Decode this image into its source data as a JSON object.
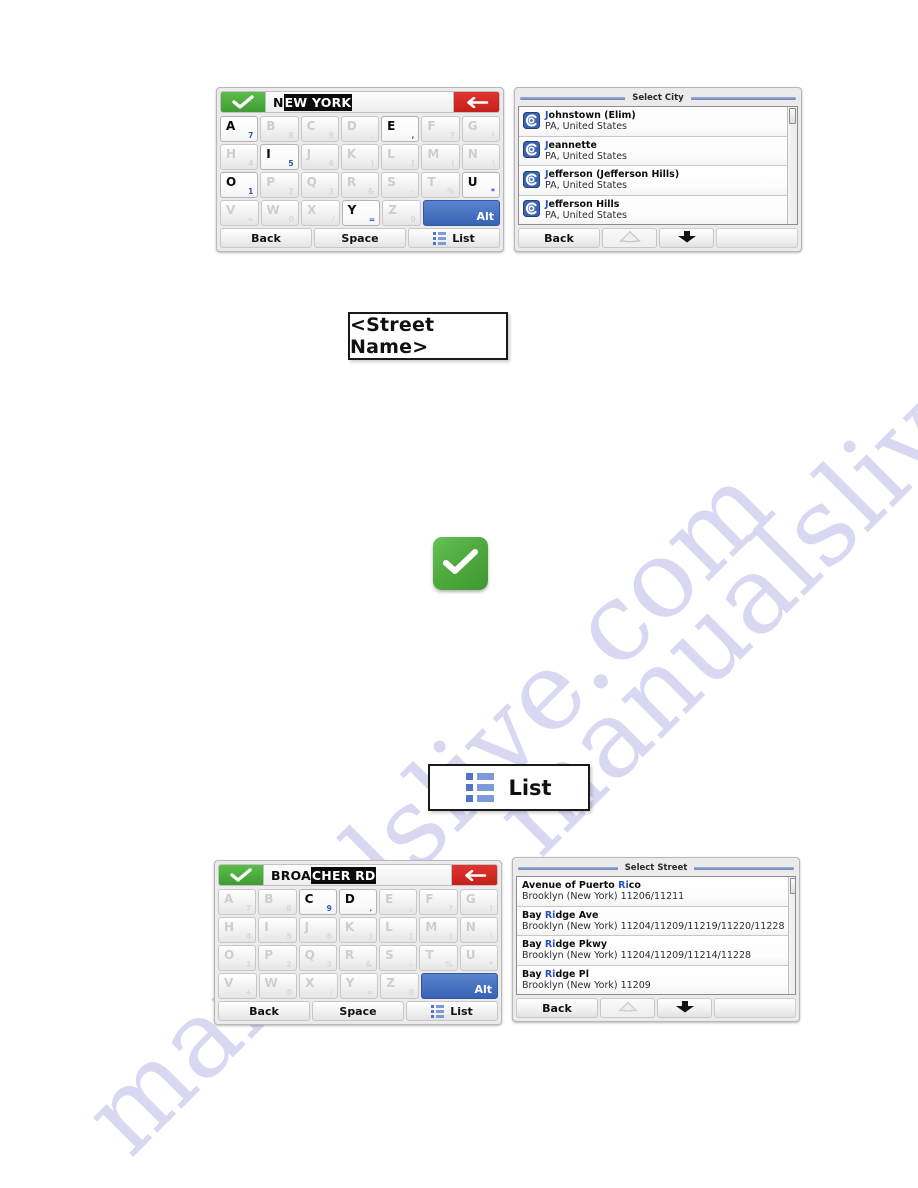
{
  "watermark": {
    "line1": "manualslive.com",
    "line2": "manualslive.com"
  },
  "city_keyboard": {
    "typed_text": "N",
    "completion_text": "EW YORK",
    "ok_icon": "check-icon",
    "back_icon": "left-arrow-icon",
    "rows": [
      [
        {
          "letter": "A",
          "sub": "7",
          "active": true
        },
        {
          "letter": "B",
          "sub": "8",
          "active": false
        },
        {
          "letter": "C",
          "sub": "9",
          "active": false
        },
        {
          "letter": "D",
          "sub": ".",
          "active": false
        },
        {
          "letter": "E",
          "sub": ",",
          "active": true
        },
        {
          "letter": "F",
          "sub": "?",
          "active": false
        },
        {
          "letter": "G",
          "sub": "!",
          "active": false
        }
      ],
      [
        {
          "letter": "H",
          "sub": "4",
          "active": false
        },
        {
          "letter": "I",
          "sub": "5",
          "active": true
        },
        {
          "letter": "J",
          "sub": "6",
          "active": false
        },
        {
          "letter": "K",
          "sub": ")",
          "active": false
        },
        {
          "letter": "L",
          "sub": "]",
          "active": false
        },
        {
          "letter": "M",
          "sub": "(",
          "active": false
        },
        {
          "letter": "N",
          "sub": "\\",
          "active": false
        }
      ],
      [
        {
          "letter": "O",
          "sub": "1",
          "active": true
        },
        {
          "letter": "P",
          "sub": "2",
          "active": false
        },
        {
          "letter": "Q",
          "sub": "3",
          "active": false
        },
        {
          "letter": "R",
          "sub": "&",
          "active": false
        },
        {
          "letter": "S",
          "sub": "-",
          "active": false
        },
        {
          "letter": "T",
          "sub": "%",
          "active": false
        },
        {
          "letter": "U",
          "sub": "*",
          "active": true
        }
      ],
      [
        {
          "letter": "V",
          "sub": "+",
          "active": false
        },
        {
          "letter": "W",
          "sub": "0",
          "active": false
        },
        {
          "letter": "X",
          "sub": "/",
          "active": false
        },
        {
          "letter": "Y",
          "sub": "=",
          "active": true
        },
        {
          "letter": "Z",
          "sub": "0",
          "active": false
        }
      ]
    ],
    "alt_label": "Alt",
    "back_label": "Back",
    "space_label": "Space",
    "list_label": "List",
    "list_icon": "list-icon"
  },
  "city_list": {
    "title": "Select City",
    "row_icon": "city-swirl-icon",
    "items": [
      {
        "highlight": "J",
        "name_rest": "ohnstown (Elim)",
        "subtitle": "PA, United States"
      },
      {
        "highlight": "J",
        "name_rest": "eannette",
        "subtitle": "PA, United States"
      },
      {
        "highlight": "J",
        "name_rest": "efferson (Jefferson Hills)",
        "subtitle": "PA, United States"
      },
      {
        "highlight": "J",
        "name_rest": "efferson Hills",
        "subtitle": "PA, United States"
      }
    ],
    "back_label": "Back",
    "up_icon": "up-arrow-icon",
    "down_icon": "down-arrow-icon"
  },
  "callout_street_name": {
    "label": "<Street Name>"
  },
  "callout_check": {
    "icon": "green-check-icon"
  },
  "callout_list": {
    "label": "List",
    "icon": "list-icon"
  },
  "street_keyboard": {
    "typed_text": "BROA",
    "completion_text": "CHER RD",
    "ok_icon": "check-icon",
    "back_icon": "left-arrow-icon",
    "rows": [
      [
        {
          "letter": "A",
          "sub": "7",
          "active": false
        },
        {
          "letter": "B",
          "sub": "8",
          "active": false
        },
        {
          "letter": "C",
          "sub": "9",
          "active": true
        },
        {
          "letter": "D",
          "sub": ".",
          "active": true
        },
        {
          "letter": "E",
          "sub": ",",
          "active": false
        },
        {
          "letter": "F",
          "sub": "?",
          "active": false
        },
        {
          "letter": "G",
          "sub": "!",
          "active": false
        }
      ],
      [
        {
          "letter": "H",
          "sub": "4",
          "active": false
        },
        {
          "letter": "I",
          "sub": "5",
          "active": false
        },
        {
          "letter": "J",
          "sub": "6",
          "active": false
        },
        {
          "letter": "K",
          "sub": ")",
          "active": false
        },
        {
          "letter": "L",
          "sub": "]",
          "active": false
        },
        {
          "letter": "M",
          "sub": "(",
          "active": false
        },
        {
          "letter": "N",
          "sub": "\\",
          "active": false
        }
      ],
      [
        {
          "letter": "O",
          "sub": "1",
          "active": false
        },
        {
          "letter": "P",
          "sub": "2",
          "active": false
        },
        {
          "letter": "Q",
          "sub": "3",
          "active": false
        },
        {
          "letter": "R",
          "sub": "&",
          "active": false
        },
        {
          "letter": "S",
          "sub": "-",
          "active": false
        },
        {
          "letter": "T",
          "sub": "%",
          "active": false
        },
        {
          "letter": "U",
          "sub": "*",
          "active": false
        }
      ],
      [
        {
          "letter": "V",
          "sub": "+",
          "active": false
        },
        {
          "letter": "W",
          "sub": "0",
          "active": false
        },
        {
          "letter": "X",
          "sub": "/",
          "active": false
        },
        {
          "letter": "Y",
          "sub": "=",
          "active": false
        },
        {
          "letter": "Z",
          "sub": "0",
          "active": false
        }
      ]
    ],
    "alt_label": "Alt",
    "back_label": "Back",
    "space_label": "Space",
    "list_label": "List",
    "list_icon": "list-icon"
  },
  "street_list": {
    "title": "Select Street",
    "items": [
      {
        "pre": "Avenue of Puerto ",
        "highlight": "Ri",
        "post": "co",
        "subtitle": "Brooklyn (New York) 11206/11211"
      },
      {
        "pre": "Bay ",
        "highlight": "Ri",
        "post": "dge Ave",
        "subtitle": "Brooklyn (New York) 11204/11209/11219/11220/11228"
      },
      {
        "pre": "Bay ",
        "highlight": "Ri",
        "post": "dge Pkwy",
        "subtitle": "Brooklyn (New York) 11204/11209/11214/11228"
      },
      {
        "pre": "Bay ",
        "highlight": "Ri",
        "post": "dge Pl",
        "subtitle": "Brooklyn (New York) 11209"
      }
    ],
    "back_label": "Back",
    "up_icon": "up-arrow-icon",
    "down_icon": "down-arrow-icon"
  },
  "colors": {
    "green": "#4faa3f",
    "red": "#c4201b",
    "blue_accent": "#2952bd",
    "alt_blue": "#3863b4",
    "watermark": "#d8d8f2"
  }
}
